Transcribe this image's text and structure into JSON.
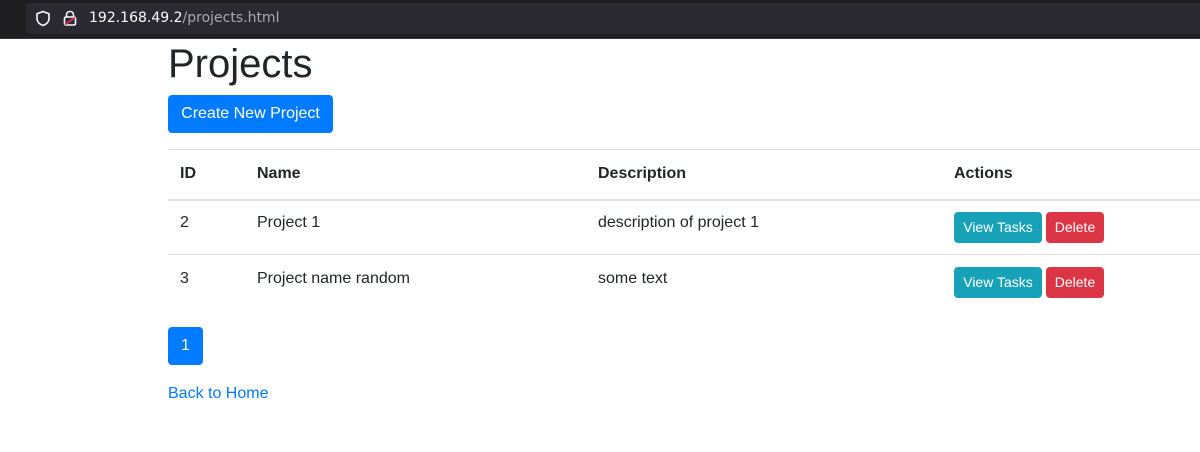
{
  "browser": {
    "url_host": "192.168.49.2",
    "url_path": "/projects.html"
  },
  "page": {
    "title": "Projects",
    "create_button_label": "Create New Project",
    "back_link_label": "Back to Home"
  },
  "table": {
    "headers": [
      "ID",
      "Name",
      "Description",
      "Actions"
    ],
    "rows": [
      {
        "id": "2",
        "name": "Project 1",
        "description": "description of project 1",
        "view_label": "View Tasks",
        "delete_label": "Delete"
      },
      {
        "id": "3",
        "name": "Project name random",
        "description": "some text",
        "view_label": "View Tasks",
        "delete_label": "Delete"
      }
    ]
  },
  "pagination": {
    "pages": [
      "1"
    ],
    "current": "1"
  },
  "colors": {
    "primary": "#007bff",
    "info": "#17a2b8",
    "danger": "#dc3545"
  },
  "icons": {
    "tracking_protection": "shield-icon",
    "connection": "lock-icon"
  }
}
